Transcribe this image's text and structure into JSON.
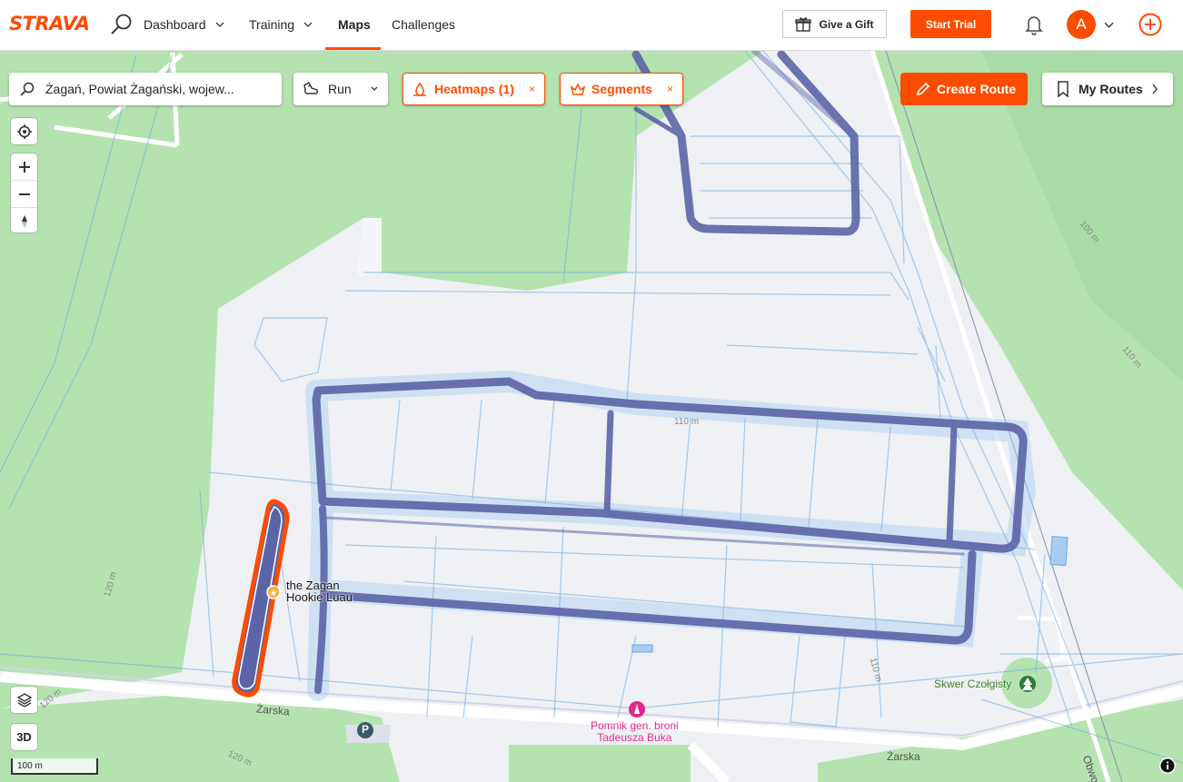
{
  "nav": {
    "logo": "STRAVA",
    "items": [
      {
        "label": "Dashboard"
      },
      {
        "label": "Training"
      },
      {
        "label": "Maps"
      },
      {
        "label": "Challenges"
      }
    ],
    "gift_label": "Give a Gift",
    "trial_label": "Start Trial",
    "avatar_initial": "A"
  },
  "toolbar": {
    "search_value": "Żagań, Powiat Żagański, wojew...",
    "sport_value": "Run",
    "heatmaps_label": "Heatmaps (1)",
    "segments_label": "Segments",
    "chip_close": "×",
    "create_route_label": "Create Route",
    "my_routes_label": "My Routes"
  },
  "map_controls": {
    "threed_label": "3D",
    "scale_label": "100 m"
  },
  "labels": {
    "poi_name_line1": "the Zagan",
    "poi_name_line2": "Hookie Luau",
    "street_1": "Żarska",
    "street_2": "Żarska",
    "street_3": "Obwo",
    "monument_line1": "Pomnik gen. broni",
    "monument_line2": "Tadeusza Buka",
    "park": "Skwer Czołgisty",
    "contour_110a": "110 m",
    "contour_110b": "110 m",
    "contour_110c": "110 m",
    "contour_100": "100 m",
    "contour_120a": "120 m",
    "contour_120b": "120 m",
    "contour_120c": "120 m",
    "parking": "P"
  },
  "colors": {
    "accent": "#fc4c02",
    "park_green": "#b5e3b0",
    "heat_dark": "#5b64a8",
    "heat_light": "#6aa9e0"
  }
}
